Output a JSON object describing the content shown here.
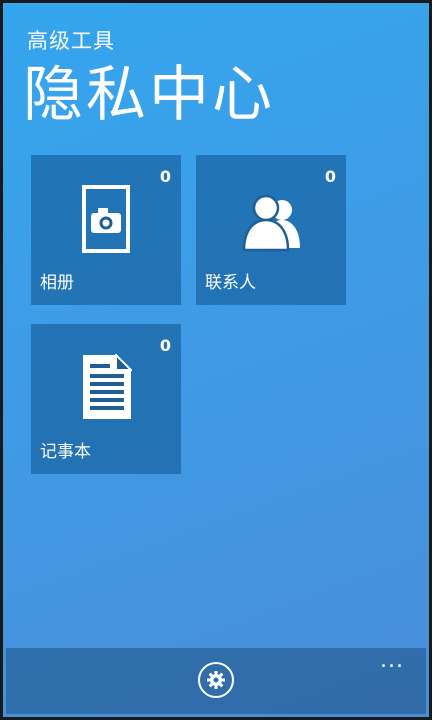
{
  "header": {
    "app_subtitle": "高级工具",
    "page_title": "隐私中心"
  },
  "tiles": [
    {
      "label": "相册",
      "count": "0",
      "icon": "photo-album-icon"
    },
    {
      "label": "联系人",
      "count": "0",
      "icon": "contacts-icon"
    },
    {
      "label": "记事本",
      "count": "0",
      "icon": "notepad-icon"
    }
  ],
  "app_bar": {
    "settings_icon": "gear-icon",
    "more_label": "..."
  },
  "colors": {
    "background": "#3a9fe9",
    "tile": "#1f5f95",
    "text": "#ffffff"
  }
}
